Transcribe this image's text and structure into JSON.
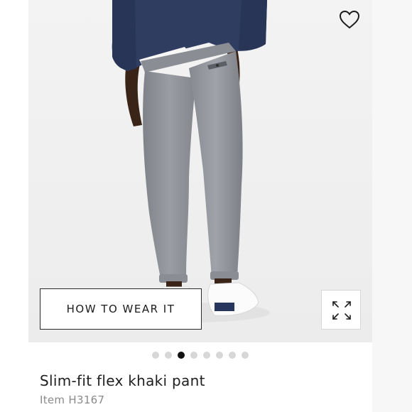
{
  "product": {
    "title": "Slim-fit flex khaki pant",
    "item_number": "Item H3167",
    "image_alt": "Model wearing grey slim-fit pants and white sneakers"
  },
  "actions": {
    "how_to_wear_label": "HOW TO WEAR IT",
    "favorite_icon": "heart-icon",
    "expand_icon": "expand-icon"
  },
  "carousel": {
    "total": 8,
    "active_index": 2
  },
  "colors": {
    "pant": "#8e9197",
    "sweater": "#2c3a5c",
    "active_dot": "#111111",
    "inactive_dot": "#d7d7d7"
  }
}
